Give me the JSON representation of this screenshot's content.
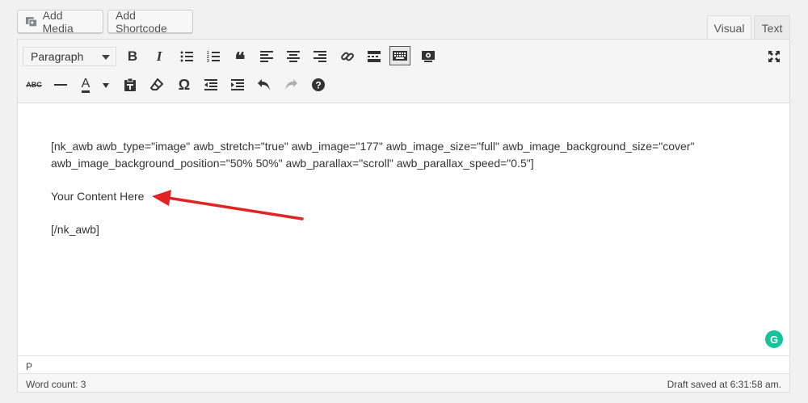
{
  "media_buttons": {
    "add_media": "Add Media",
    "add_shortcode": "Add Shortcode"
  },
  "tabs": {
    "visual": "Visual",
    "text": "Text",
    "active": "Visual"
  },
  "toolbar": {
    "format_select": "Paragraph",
    "row1_icons": [
      "bold-icon",
      "italic-icon",
      "bulleted-list-icon",
      "numbered-list-icon",
      "blockquote-icon",
      "align-left-icon",
      "align-center-icon",
      "align-right-icon",
      "link-icon",
      "read-more-icon",
      "toolbar-toggle-icon",
      "preview-icon"
    ],
    "row2_icons": [
      "strikethrough-icon",
      "horizontal-line-icon",
      "text-color-icon",
      "paste-as-text-icon",
      "clear-formatting-icon",
      "special-character-icon",
      "outdent-icon",
      "indent-icon",
      "undo-icon",
      "redo-icon",
      "help-icon"
    ],
    "fullscreen_icon": "fullscreen-icon"
  },
  "content": {
    "shortcode_open": "[nk_awb awb_type=\"image\" awb_stretch=\"true\" awb_image=\"177\" awb_image_size=\"full\" awb_image_background_size=\"cover\" awb_image_background_position=\"50% 50%\" awb_parallax=\"scroll\" awb_parallax_speed=\"0.5\"]",
    "body_text": "Your Content Here",
    "shortcode_close": "[/nk_awb]"
  },
  "annotation": {
    "arrow_color": "#e02424"
  },
  "grammarly_badge": "G",
  "colors": {
    "grammarly": "#15c39a"
  },
  "status": {
    "path": "P",
    "word_count": "Word count: 3",
    "draft_saved": "Draft saved at 6:31:58 am."
  }
}
